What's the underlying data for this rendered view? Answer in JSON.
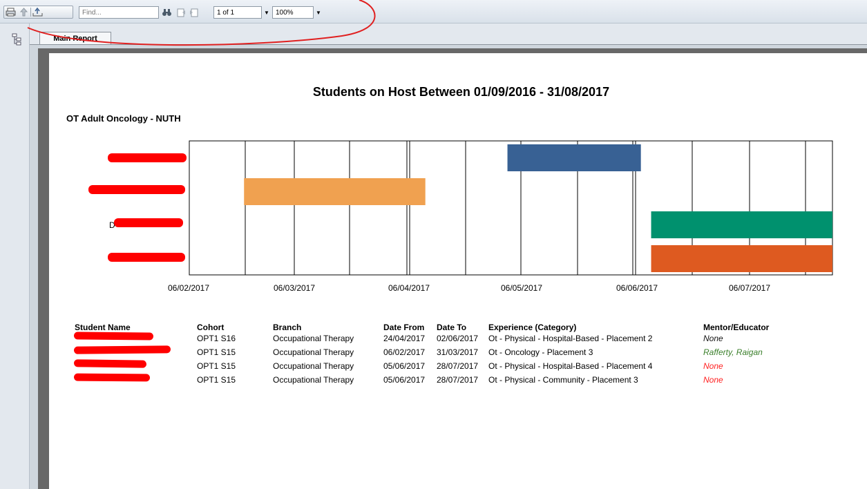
{
  "toolbar": {
    "find_placeholder": "Find...",
    "page_value": "1 of 1",
    "zoom_value": "100%"
  },
  "tabs": {
    "main_report": "Main Report"
  },
  "report": {
    "title": "Students on Host Between 01/09/2016 - 31/08/2017",
    "subtitle": "OT Adult Oncology - NUTH"
  },
  "chart_data": {
    "type": "bar",
    "orientation": "horizontal-gantt",
    "x_ticks": [
      "06/02/2017",
      "06/03/2017",
      "06/04/2017",
      "06/05/2017",
      "06/06/2017",
      "06/07/2017"
    ],
    "series": [
      {
        "row": 1,
        "start": "2017-04-24",
        "end": "2017-06-02",
        "color": "#386194"
      },
      {
        "row": 2,
        "start": "2017-02-06",
        "end": "2017-03-31",
        "color": "#f0a150"
      },
      {
        "row": 3,
        "start": "2017-06-05",
        "end": "2017-07-28",
        "color": "#00916e"
      },
      {
        "row": 4,
        "start": "2017-06-05",
        "end": "2017-07-28",
        "color": "#de5a20"
      }
    ],
    "row_label_fragments": [
      "",
      "",
      "D",
      ""
    ]
  },
  "table": {
    "headers": {
      "student": "Student Name",
      "cohort": "Cohort",
      "branch": "Branch",
      "from": "Date From",
      "to": "Date To",
      "experience": "Experience (Category)",
      "mentor": "Mentor/Educator"
    },
    "rows": [
      {
        "cohort": "OPT1 S16",
        "branch": "Occupational Therapy",
        "from": "24/04/2017",
        "to": "02/06/2017",
        "experience": "Ot - Physical - Hospital-Based - Placement 2",
        "mentor": "None"
      },
      {
        "cohort": "OPT1 S15",
        "branch": "Occupational Therapy",
        "from": "06/02/2017",
        "to": "31/03/2017",
        "experience": "Ot - Oncology - Placement 3",
        "mentor": "Rafferty, Raigan"
      },
      {
        "cohort": "OPT1 S15",
        "branch": "Occupational Therapy",
        "from": "05/06/2017",
        "to": "28/07/2017",
        "experience": "Ot - Physical - Hospital-Based - Placement 4",
        "mentor": "None"
      },
      {
        "cohort": "OPT1 S15",
        "branch": "Occupational Therapy",
        "from": "05/06/2017",
        "to": "28/07/2017",
        "experience": "Ot - Physical - Community - Placement 3",
        "mentor": "None"
      }
    ]
  },
  "colors": {
    "redaction": "#ff0000",
    "annotation": "#e02020"
  }
}
